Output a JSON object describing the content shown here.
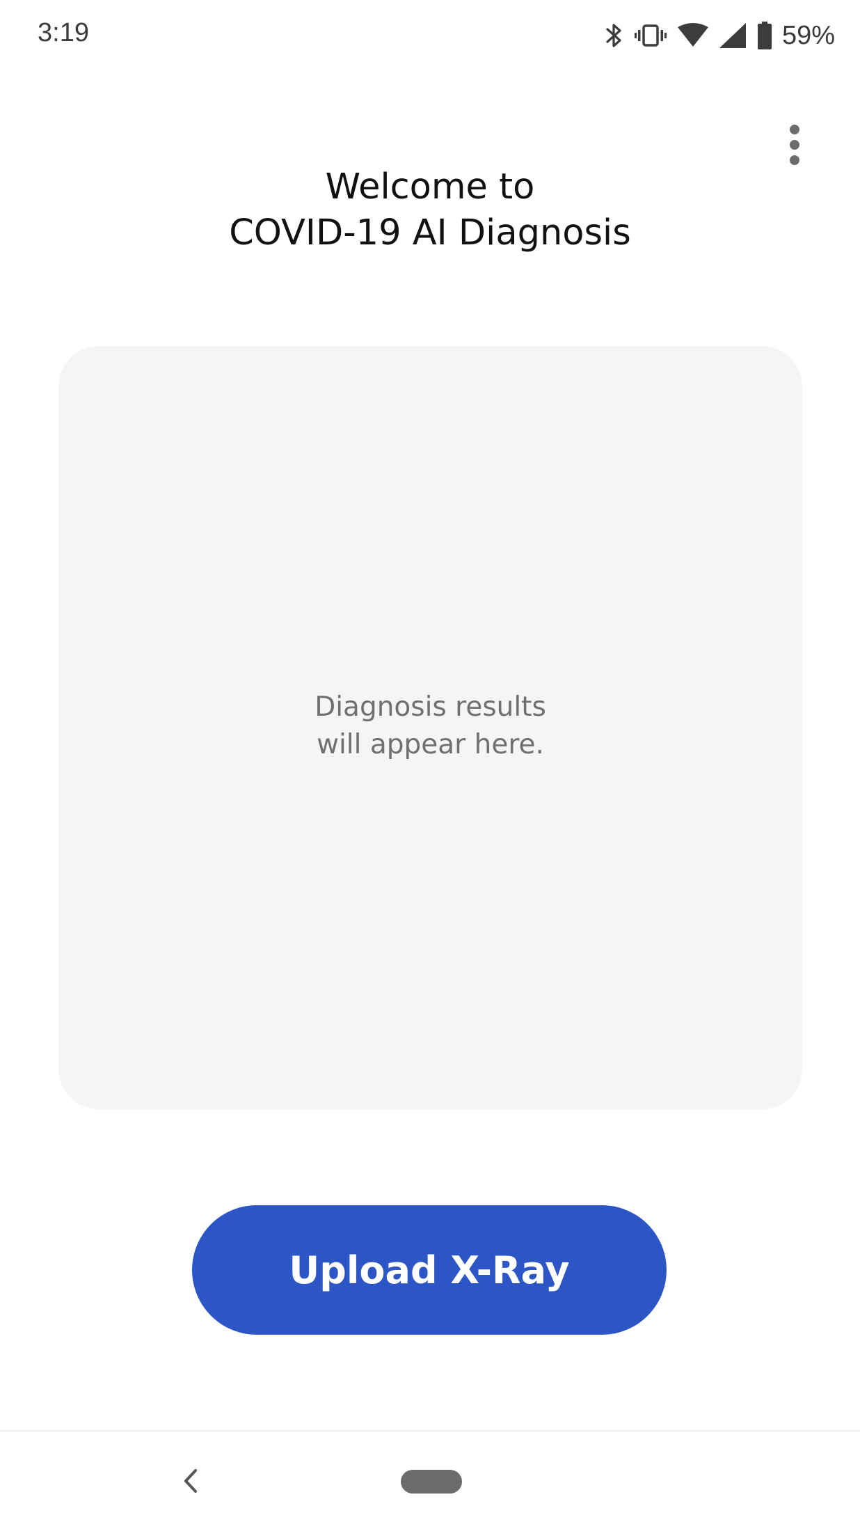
{
  "status_bar": {
    "time": "3:19",
    "battery_percent": "59%",
    "icons": [
      "bluetooth-icon",
      "vibrate-icon",
      "wifi-icon",
      "cell-signal-icon",
      "battery-icon"
    ]
  },
  "header": {
    "title_line1": "Welcome to",
    "title_line2": "COVID-19 AI Diagnosis",
    "overflow_icon": "more-vert-icon"
  },
  "result_card": {
    "placeholder_line1": "Diagnosis results",
    "placeholder_line2": "will appear here."
  },
  "actions": {
    "upload_label": "Upload X-Ray"
  },
  "nav_bar": {
    "back_icon": "back-chevron-icon",
    "home_icon": "home-pill-icon"
  },
  "colors": {
    "accent": "#2c56c6",
    "card_background": "#f5f5f5",
    "placeholder_text": "#707070",
    "title_text": "#111111"
  }
}
